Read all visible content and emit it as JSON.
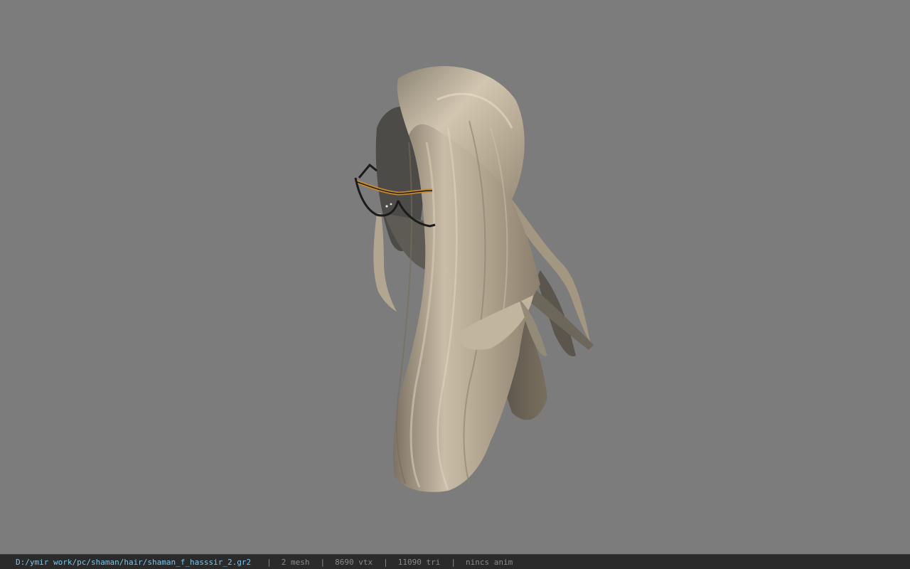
{
  "viewer": {
    "background_color": "#7c7c7c",
    "model": {
      "name": "hair-with-glasses-model",
      "hair_color": "#b9ac96",
      "glasses_frame_color": "#c98a2e"
    }
  },
  "status_bar": {
    "file_path": "D:/ymir work/pc/shaman/hair/shaman_f_hasssir_2.gr2",
    "mesh_count": "2 mesh",
    "vertex_count": "8690 vtx",
    "triangle_count": "11090 tri",
    "anim_info": "nincs anim",
    "separator": "|"
  }
}
